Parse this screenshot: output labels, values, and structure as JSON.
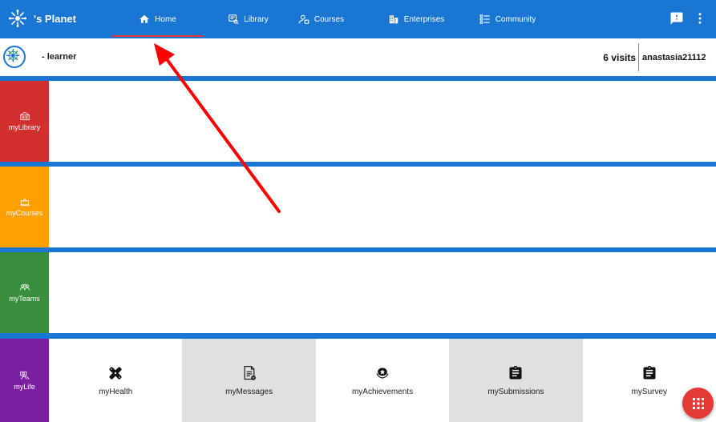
{
  "header": {
    "brand": "'s Planet",
    "nav": [
      {
        "label": "Home",
        "icon": "home-icon",
        "active": true
      },
      {
        "label": "Library",
        "icon": "library-icon"
      },
      {
        "label": "Courses",
        "icon": "courses-icon"
      },
      {
        "label": "Enterprises",
        "icon": "enterprises-icon"
      },
      {
        "label": "Community",
        "icon": "community-icon"
      }
    ]
  },
  "infobar": {
    "role": "- learner",
    "visits": "6 visits",
    "username": "anastasia21112"
  },
  "sections": {
    "library": {
      "label": "myLibrary",
      "color": "#d32f2f"
    },
    "courses": {
      "label": "myCourses",
      "color": "#ffa000"
    },
    "teams": {
      "label": "myTeams",
      "color": "#388e3c"
    },
    "life": {
      "label": "myLife",
      "color": "#7b1fa2"
    }
  },
  "life_tiles": [
    {
      "label": "myHealth",
      "icon": "health-icon"
    },
    {
      "label": "myMessages",
      "icon": "messages-icon"
    },
    {
      "label": "myAchievements",
      "icon": "achievements-icon"
    },
    {
      "label": "mySubmissions",
      "icon": "submissions-icon"
    },
    {
      "label": "mySurvey",
      "icon": "survey-icon"
    }
  ],
  "colors": {
    "primary": "#1976d2",
    "accent": "#e53935",
    "tile_grey": "#e0e0e0"
  }
}
